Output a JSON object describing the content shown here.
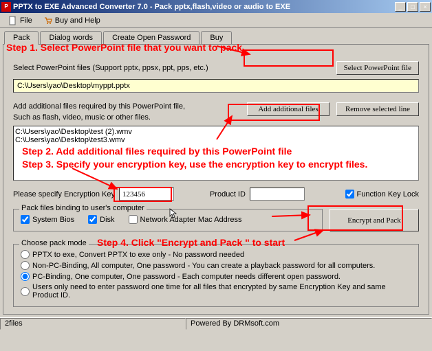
{
  "titlebar": "PPTX to EXE Advanced Converter 7.0 - Pack pptx,flash,video or audio to EXE",
  "menu": {
    "file": "File",
    "buyhelp": "Buy and Help"
  },
  "tabs": [
    "Pack",
    "Dialog words",
    "Create Open Password",
    "Buy"
  ],
  "annotations": {
    "step1": "Step 1. Select PowerPoint file that you want to pack.",
    "step2": "Step 2. Add additional files required by this PowerPoint file",
    "step3": "Step 3. Specify your encryption key, use the encryption key to encrypt files.",
    "step4": "Step 4. Click \"Encrypt and Pack \" to start"
  },
  "selectPptLabel": "Select PowerPoint files (Support pptx, ppsx, ppt, pps, etc.)",
  "selectPptBtn": "Select PowerPoint file",
  "pptPath": "C:\\Users\\yao\\Desktop\\myppt.pptx",
  "addLabel1": "Add additional files required by this PowerPoint file,",
  "addLabel2": "Such as flash, video, music or other files.",
  "addBtn": "Add additional files",
  "removeBtn": "Remove selected line",
  "listItems": [
    "C:\\Users\\yao\\Desktop\\test (2).wmv",
    "C:\\Users\\yao\\Desktop\\test3.wmv"
  ],
  "keyLabel": "Please specify Encryption Key",
  "keyValue": "123456",
  "productIdLabel": "Product ID",
  "productIdValue": "",
  "funcKeyLock": "Function Key Lock",
  "bindGroup": "Pack files binding to user's computer",
  "bindOpts": {
    "sysbios": "System Bios",
    "disk": "Disk",
    "mac": "Network Adapter Mac Address"
  },
  "encryptBtn": "Encrypt and Pack",
  "modeGroup": "Choose pack mode",
  "modes": [
    "PPTX to exe, Convert PPTX to exe only - No password needed",
    "Non-PC-Binding, All computer, One password  - You can create a playback password for all computers.",
    "PC-Binding, One computer, One password  - Each computer needs different open password.",
    "Users only need to enter password one time for all files that encrypted by same Encryption Key and same Product ID."
  ],
  "status": {
    "left": "2files",
    "right": "Powered By DRMsoft.com"
  }
}
